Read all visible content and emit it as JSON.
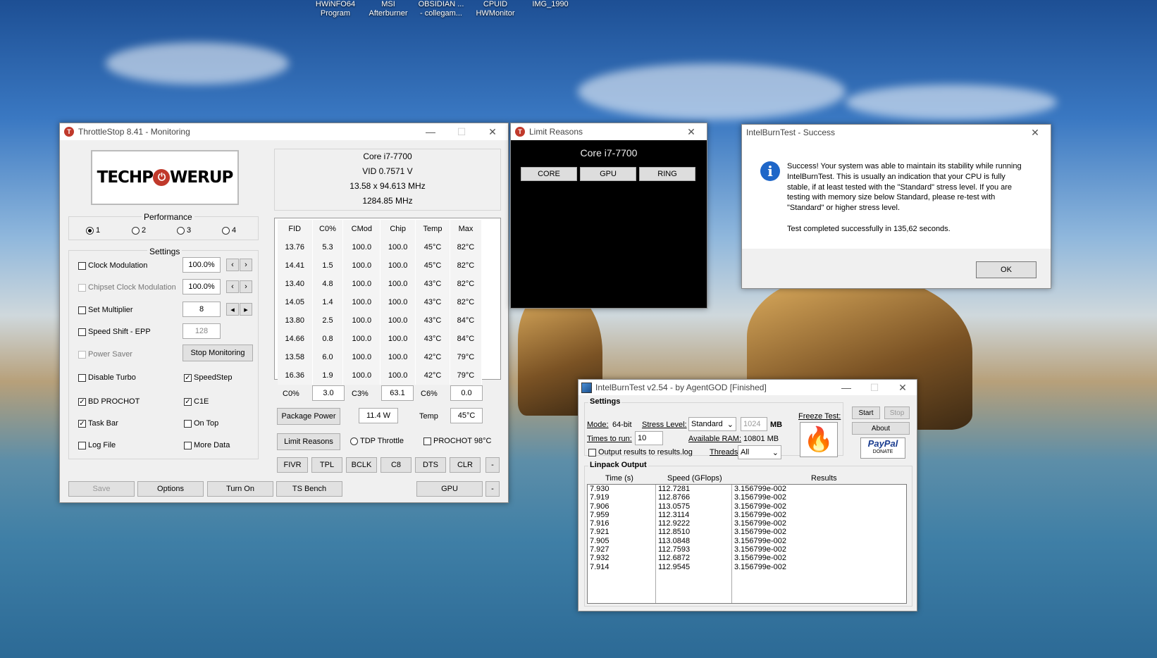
{
  "desktop": {
    "icons": [
      {
        "line1": "HWiNFO64",
        "line2": "Program"
      },
      {
        "line1": "MSI",
        "line2": "Afterburner"
      },
      {
        "line1": "OBSIDIAN ...",
        "line2": "- collegam..."
      },
      {
        "line1": "CPUID",
        "line2": "HWMonitor"
      },
      {
        "line1": "IMG_1990",
        "line2": ""
      }
    ]
  },
  "throttlestop": {
    "title": "ThrottleStop 8.41 - Monitoring",
    "logo_text_a": "TECHP",
    "logo_text_b": "WERUP",
    "cpu_name": "Core i7-7700",
    "vid": "VID  0.7571 V",
    "multiplier_line": "13.58 x 94.613 MHz",
    "mhz_line": "1284.85 MHz",
    "performance_label": "Performance",
    "performance_options": [
      "1",
      "2",
      "3",
      "4"
    ],
    "settings_label": "Settings",
    "settings": {
      "clock_modulation": "Clock Modulation",
      "clock_modulation_value": "100.0%",
      "chipset_clock_modulation": "Chipset Clock Modulation",
      "chipset_value": "100.0%",
      "set_multiplier": "Set Multiplier",
      "multiplier_value": "8",
      "speed_shift": "Speed Shift - EPP",
      "epp_value": "128",
      "power_saver": "Power Saver",
      "stop_monitoring": "Stop Monitoring",
      "disable_turbo": "Disable Turbo",
      "speedstep": "SpeedStep",
      "bd_prochot": "BD PROCHOT",
      "c1e": "C1E",
      "task_bar": "Task Bar",
      "on_top": "On Top",
      "log_file": "Log File",
      "more_data": "More Data"
    },
    "table": {
      "headers": [
        "FID",
        "C0%",
        "CMod",
        "Chip",
        "Temp",
        "Max"
      ],
      "rows": [
        [
          "13.76",
          "5.3",
          "100.0",
          "100.0",
          "45°C",
          "82°C"
        ],
        [
          "14.41",
          "1.5",
          "100.0",
          "100.0",
          "45°C",
          "82°C"
        ],
        [
          "13.40",
          "4.8",
          "100.0",
          "100.0",
          "43°C",
          "82°C"
        ],
        [
          "14.05",
          "1.4",
          "100.0",
          "100.0",
          "43°C",
          "82°C"
        ],
        [
          "13.80",
          "2.5",
          "100.0",
          "100.0",
          "43°C",
          "84°C"
        ],
        [
          "14.66",
          "0.8",
          "100.0",
          "100.0",
          "43°C",
          "84°C"
        ],
        [
          "13.58",
          "6.0",
          "100.0",
          "100.0",
          "42°C",
          "79°C"
        ],
        [
          "16.36",
          "1.9",
          "100.0",
          "100.0",
          "42°C",
          "79°C"
        ]
      ]
    },
    "c0_label": "C0%",
    "c0_value": "3.0",
    "c3_label": "C3%",
    "c3_value": "63.1",
    "c6_label": "C6%",
    "c6_value": "0.0",
    "package_power": "Package Power",
    "package_power_value": "11.4 W",
    "temp_label": "Temp",
    "temp_value": "45°C",
    "limit_reasons": "Limit Reasons",
    "tdp_throttle": "TDP Throttle",
    "prochot": "PROCHOT 98°C",
    "small_buttons": [
      "FIVR",
      "TPL",
      "BCLK",
      "C8",
      "DTS",
      "CLR",
      "-"
    ],
    "bottom_buttons": {
      "save": "Save",
      "options": "Options",
      "turn_on": "Turn On",
      "ts_bench": "TS Bench",
      "gpu": "GPU",
      "dash": "-"
    }
  },
  "limit_reasons": {
    "title": "Limit Reasons",
    "cpu_name": "Core i7-7700",
    "buttons": [
      "CORE",
      "GPU",
      "RING"
    ]
  },
  "ibt_success": {
    "title": "IntelBurnTest - Success",
    "message": "Success! Your system was able to maintain its stability while running IntelBurnTest. This is usually an indication that your CPU is fully stable, if at least tested with the \"Standard\" stress level. If you are testing with memory size below Standard, please re-test with \"Standard\" or higher stress level.",
    "completed": "Test completed successfully in 135,62 seconds.",
    "ok": "OK"
  },
  "ibt": {
    "title": "IntelBurnTest v2.54 - by AgentGOD [Finished]",
    "settings_label": "Settings",
    "mode_label": "Mode:",
    "mode_value": "64-bit",
    "stress_label": "Stress Level:",
    "stress_value": "Standard",
    "mem_value": "1024",
    "mem_unit": "MB",
    "times_label": "Times to run:",
    "times_value": "10",
    "ram_label": "Available RAM:",
    "ram_value": "10801 MB",
    "output_log": "Output results to results.log",
    "threads_label": "Threads:",
    "threads_value": "All",
    "freeze_test": "Freeze Test:",
    "start": "Start",
    "stop": "Stop",
    "about": "About",
    "paypal": "PayPal",
    "donate": "DONATE",
    "linpack_label": "Linpack Output",
    "col_time": "Time (s)",
    "col_speed": "Speed (GFlops)",
    "col_results": "Results",
    "rows": [
      [
        "7.930",
        "112.7281",
        "3.156799e-002"
      ],
      [
        "7.919",
        "112.8766",
        "3.156799e-002"
      ],
      [
        "7.906",
        "113.0575",
        "3.156799e-002"
      ],
      [
        "7.959",
        "112.3114",
        "3.156799e-002"
      ],
      [
        "7.916",
        "112.9222",
        "3.156799e-002"
      ],
      [
        "7.921",
        "112.8510",
        "3.156799e-002"
      ],
      [
        "7.905",
        "113.0848",
        "3.156799e-002"
      ],
      [
        "7.927",
        "112.7593",
        "3.156799e-002"
      ],
      [
        "7.932",
        "112.6872",
        "3.156799e-002"
      ],
      [
        "7.914",
        "112.9545",
        "3.156799e-002"
      ]
    ]
  }
}
